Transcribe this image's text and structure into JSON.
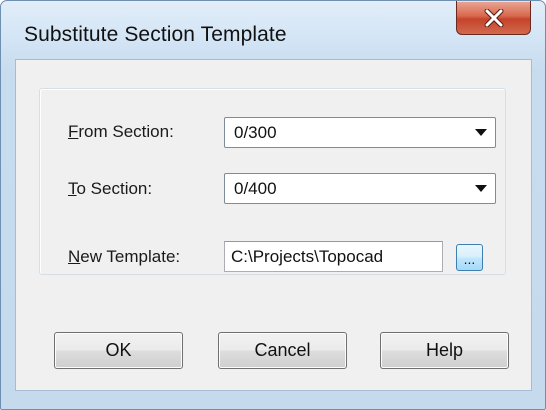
{
  "window": {
    "title": "Substitute Section Template",
    "close_label": "X"
  },
  "fields": {
    "from_section": {
      "label_mnemonic": "F",
      "label_rest": "rom Section:",
      "value": "0/300"
    },
    "to_section": {
      "label_mnemonic": "T",
      "label_rest": "o Section:",
      "value": "0/400"
    },
    "new_template": {
      "label_mnemonic": "N",
      "label_rest": "ew Template:",
      "value": "C:\\Projects\\Topocad",
      "browse_label": "..."
    }
  },
  "buttons": {
    "ok": "OK",
    "cancel": "Cancel",
    "help": "Help"
  },
  "colors": {
    "title_bar": "#d2e4f5",
    "close_button": "#c5442a",
    "client_bg": "#f0f0f0",
    "browse_button": "#bee6fd"
  }
}
